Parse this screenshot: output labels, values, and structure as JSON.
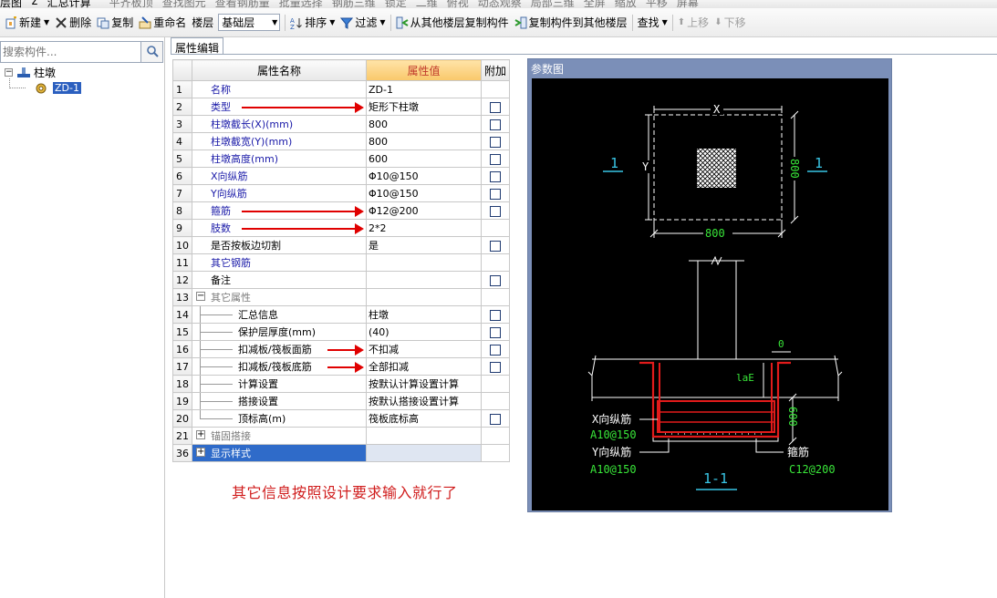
{
  "topbar": {
    "items": [
      "层图",
      "Σ",
      "汇总计算",
      "",
      "平齐板顶",
      "查找图元",
      "查看钢筋量",
      "批量选择",
      "钢筋三维",
      "锁定",
      "二维",
      "俯视",
      "动态观察",
      "局部三维",
      "全屏",
      "缩放",
      "平移",
      "屏幕"
    ]
  },
  "toolbar": {
    "new_label": "新建",
    "delete_label": "删除",
    "copy_label": "复制",
    "rename_label": "重命名",
    "floor_label": "楼层",
    "floor_value": "基础层",
    "sort_label": "排序",
    "filter_label": "过滤",
    "copy_from_label": "从其他楼层复制构件",
    "copy_to_label": "复制构件到其他楼层",
    "find_label": "查找",
    "move_up_label": "上移",
    "move_down_label": "下移"
  },
  "left_panel": {
    "search_placeholder": "搜索构件...",
    "tree_root": "柱墩",
    "tree_child": "ZD-1"
  },
  "props": {
    "tab_label": "属性编辑",
    "headers": {
      "name": "属性名称",
      "value": "属性值",
      "extra": "附加"
    },
    "rows": [
      {
        "num": "1",
        "name": "名称",
        "value": "ZD-1",
        "chk": false,
        "style": "blue"
      },
      {
        "num": "2",
        "name": "类型",
        "value": "矩形下柱墩",
        "chk": true,
        "style": "blue",
        "arrow": true
      },
      {
        "num": "3",
        "name": "柱墩截长(X)(mm)",
        "value": "800",
        "chk": true,
        "style": "blue"
      },
      {
        "num": "4",
        "name": "柱墩截宽(Y)(mm)",
        "value": "800",
        "chk": true,
        "style": "blue"
      },
      {
        "num": "5",
        "name": "柱墩高度(mm)",
        "value": "600",
        "chk": true,
        "style": "blue"
      },
      {
        "num": "6",
        "name": "X向纵筋",
        "value": "Φ10@150",
        "chk": true,
        "style": "blue"
      },
      {
        "num": "7",
        "name": "Y向纵筋",
        "value": "Φ10@150",
        "chk": true,
        "style": "blue"
      },
      {
        "num": "8",
        "name": "箍筋",
        "value": "Φ12@200",
        "chk": true,
        "style": "blue",
        "arrow": true
      },
      {
        "num": "9",
        "name": "肢数",
        "value": "2*2",
        "chk": false,
        "style": "blue",
        "arrow": true
      },
      {
        "num": "10",
        "name": "是否按板边切割",
        "value": "是",
        "chk": true,
        "style": "plain"
      },
      {
        "num": "11",
        "name": "其它钢筋",
        "value": "",
        "chk": false,
        "style": "blue"
      },
      {
        "num": "12",
        "name": "备注",
        "value": "",
        "chk": true,
        "style": "plain"
      },
      {
        "num": "13",
        "name": "其它属性",
        "value": "",
        "chk": false,
        "style": "group-open"
      },
      {
        "num": "14",
        "name": "汇总信息",
        "value": "柱墩",
        "chk": true,
        "style": "sub"
      },
      {
        "num": "15",
        "name": "保护层厚度(mm)",
        "value": "(40)",
        "chk": true,
        "style": "sub"
      },
      {
        "num": "16",
        "name": "扣减板/筏板面筋",
        "value": "不扣减",
        "chk": true,
        "style": "sub",
        "arrow": true
      },
      {
        "num": "17",
        "name": "扣减板/筏板底筋",
        "value": "全部扣减",
        "chk": true,
        "style": "sub",
        "arrow": true
      },
      {
        "num": "18",
        "name": "计算设置",
        "value": "按默认计算设置计算",
        "chk": false,
        "style": "sub"
      },
      {
        "num": "19",
        "name": "搭接设置",
        "value": "按默认搭接设置计算",
        "chk": false,
        "style": "sub"
      },
      {
        "num": "20",
        "name": "顶标高(m)",
        "value": "筏板底标高",
        "chk": true,
        "style": "sub-last"
      },
      {
        "num": "21",
        "name": "锚固搭接",
        "value": "",
        "chk": false,
        "style": "group-closed"
      },
      {
        "num": "36",
        "name": "显示样式",
        "value": "",
        "chk": false,
        "style": "group-selected"
      }
    ]
  },
  "note": "其它信息按照设计要求输入就行了",
  "diagram": {
    "title": "参数图",
    "x_label": "X",
    "y_label": "Y",
    "section_mark": "1",
    "dim_x": "800",
    "dim_y": "800",
    "dim_zero": "0",
    "lae_label": "laE",
    "dim_h": "600",
    "x_rebar_label": "X向纵筋",
    "x_rebar_value": "A10@150",
    "y_rebar_label": "Y向纵筋",
    "y_rebar_value": "A10@150",
    "stirrup_label": "箍筋",
    "stirrup_value": "C12@200",
    "section_title": "1-1"
  }
}
